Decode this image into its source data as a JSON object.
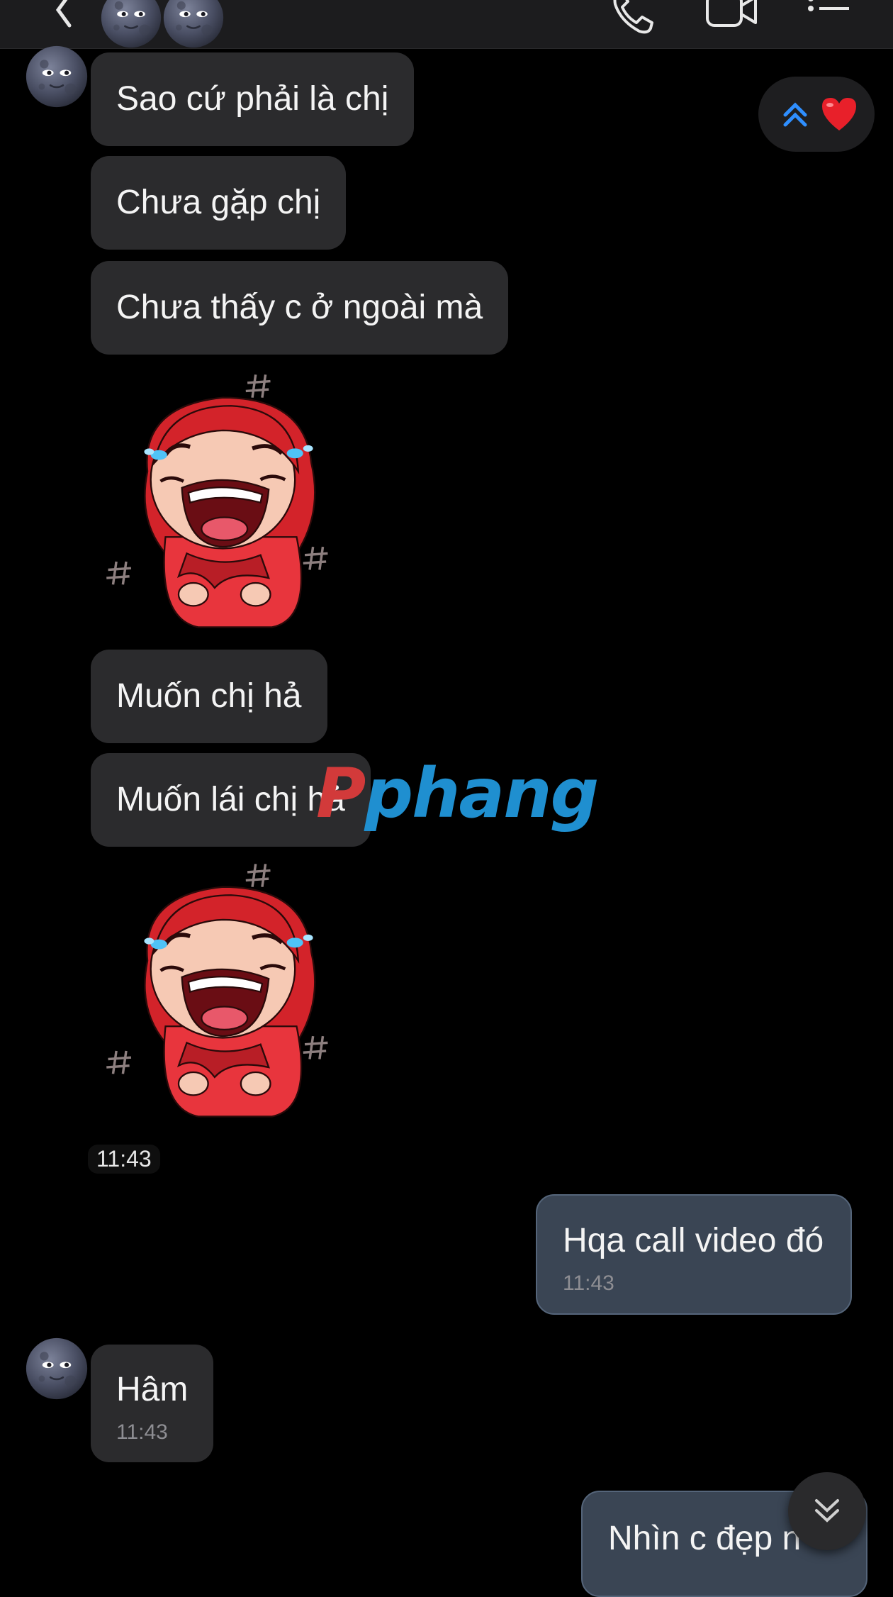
{
  "watermark": {
    "part1": "P",
    "part2": "phang"
  },
  "messages": [
    {
      "text": "Sao cứ phải là chị"
    },
    {
      "text": "Chưa gặp chị"
    },
    {
      "text": "Chưa thấy c ở ngoài mà"
    },
    {
      "text": "Muốn chị hả"
    },
    {
      "text": "Muốn lái chị hả"
    },
    {
      "text": "Hqa call video đó",
      "time": "11:43"
    },
    {
      "text": "Hâm",
      "time": "11:43"
    },
    {
      "text": "Nhìn c đẹp n"
    }
  ],
  "timestamp": "11:43",
  "colors": {
    "background": "#000000",
    "incoming_bubble": "#2b2b2d",
    "outgoing_bubble": "#3a4554",
    "accent": "#2f8fff",
    "heart": "#e8202a"
  },
  "icons": [
    "back-icon",
    "phone-icon",
    "video-call-icon",
    "menu-icon",
    "double-chevron-up-icon",
    "heart-icon",
    "double-chevron-down-icon",
    "moon-face-avatar"
  ]
}
